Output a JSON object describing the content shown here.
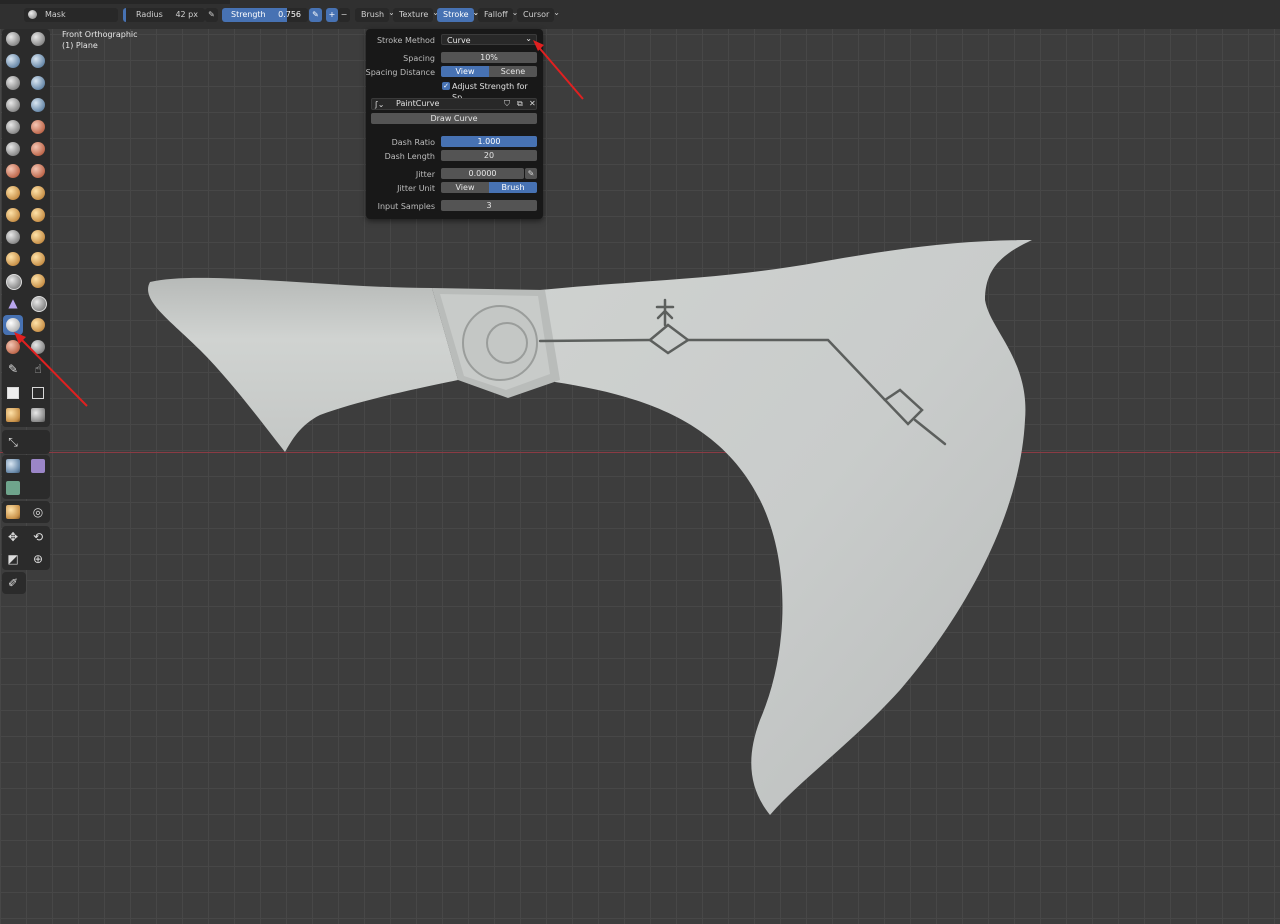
{
  "header": {
    "mode_label": "Mask",
    "radius_label": "Radius",
    "radius_value": "42 px",
    "strength_label": "Strength",
    "strength_value": "0.756",
    "strength_fraction": 0.756,
    "plus_label": "+",
    "minus_label": "−",
    "menus": [
      "Brush",
      "Texture",
      "Stroke",
      "Falloff",
      "Cursor"
    ],
    "active_menu": "Stroke"
  },
  "viewport": {
    "view_name": "Front Orthographic",
    "object_name": "(1) Plane"
  },
  "stroke_popover": {
    "stroke_method_label": "Stroke Method",
    "stroke_method_value": "Curve",
    "spacing_label": "Spacing",
    "spacing_value": "10%",
    "spacing_distance_label": "Spacing Distance",
    "spacing_distance_options": [
      "View",
      "Scene"
    ],
    "spacing_distance_selected": "View",
    "adjust_strength_label": "Adjust Strength for Sp...",
    "adjust_strength_checked": true,
    "paint_curve_name": "PaintCurve",
    "draw_curve_label": "Draw Curve",
    "dash_ratio_label": "Dash Ratio",
    "dash_ratio_value": "1.000",
    "dash_length_label": "Dash Length",
    "dash_length_value": "20",
    "jitter_label": "Jitter",
    "jitter_value": "0.0000",
    "jitter_unit_label": "Jitter Unit",
    "jitter_unit_options": [
      "View",
      "Brush"
    ],
    "jitter_unit_selected": "Brush",
    "input_samples_label": "Input Samples",
    "input_samples_value": "3"
  },
  "colors": {
    "accent": "#4772b3",
    "viewport_bg": "#3d3d3d",
    "panel_bg": "#181818",
    "axis_red": "#8a3b44",
    "annotation_arrow": "#e02020"
  },
  "icons": [
    "brush-icon",
    "eyedropper-icon",
    "chevron-down-icon",
    "checkmark-icon",
    "shield-icon",
    "duplicate-icon",
    "close-icon",
    "curve-icon"
  ]
}
